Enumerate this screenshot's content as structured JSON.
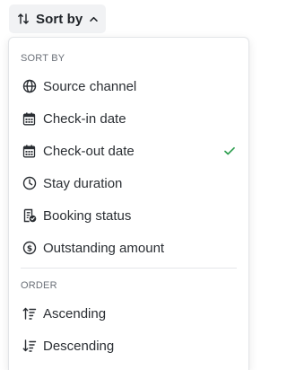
{
  "trigger": {
    "label": "Sort by",
    "icon": "sort-arrows-icon",
    "chevron": "chevron-up-icon"
  },
  "menu": {
    "sort_heading": "SORT BY",
    "sort_options": [
      {
        "label": "Source channel",
        "icon": "globe-icon",
        "selected": false
      },
      {
        "label": "Check-in date",
        "icon": "calendar-icon",
        "selected": false
      },
      {
        "label": "Check-out date",
        "icon": "calendar-icon",
        "selected": true
      },
      {
        "label": "Stay duration",
        "icon": "clock-icon",
        "selected": false
      },
      {
        "label": "Booking status",
        "icon": "document-check-icon",
        "selected": false
      },
      {
        "label": "Outstanding amount",
        "icon": "dollar-coin-icon",
        "selected": false
      }
    ],
    "order_heading": "ORDER",
    "order_options": [
      {
        "label": "Ascending",
        "icon": "sort-ascending-icon"
      },
      {
        "label": "Descending",
        "icon": "sort-descending-icon"
      }
    ]
  },
  "colors": {
    "check": "#2e9e4f",
    "trigger_bg": "#f1f2f4"
  }
}
